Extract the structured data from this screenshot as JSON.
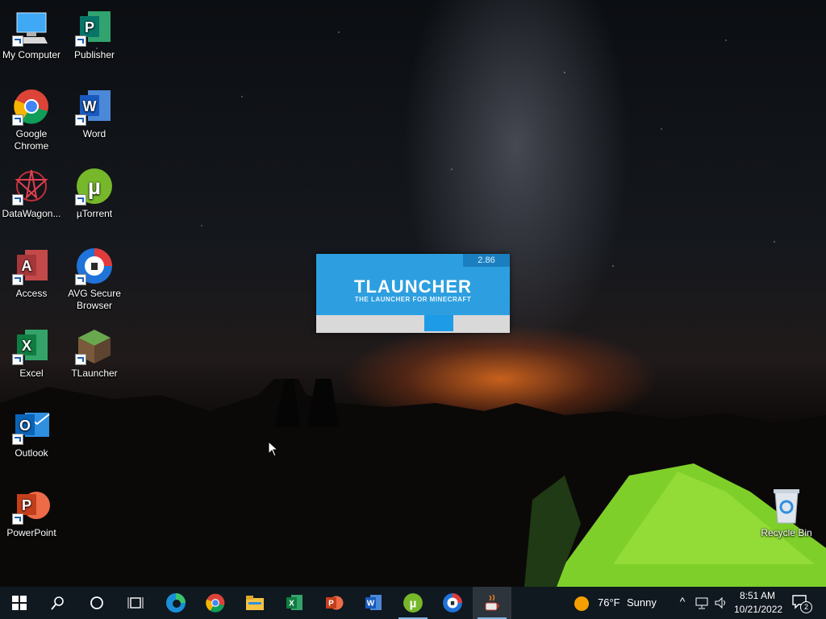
{
  "desktop_icons": [
    {
      "label": "My Computer"
    },
    {
      "label": "Publisher"
    },
    {
      "label": "Google Chrome"
    },
    {
      "label": "Word"
    },
    {
      "label": "DataWagon..."
    },
    {
      "label": "µTorrent"
    },
    {
      "label": "Access"
    },
    {
      "label": "AVG Secure Browser"
    },
    {
      "label": "Excel"
    },
    {
      "label": "TLauncher"
    },
    {
      "label": "Outlook"
    },
    {
      "label": "PowerPoint"
    },
    {
      "label": "Recycle Bin"
    }
  ],
  "splash": {
    "version": "2.86",
    "title": "TLAUNCHER",
    "subtitle": "THE LAUNCHER FOR MINECRAFT",
    "progress_fraction": 0.15,
    "progress_offset_fraction": 0.56
  },
  "taskbar": {
    "apps": [
      "start-icon",
      "search-icon",
      "cortana-icon",
      "task-view-icon",
      "edge-icon",
      "chrome-icon",
      "file-explorer-icon",
      "excel-icon",
      "powerpoint-icon",
      "word-icon",
      "utorrent-icon",
      "avg-browser-icon",
      "java-icon"
    ],
    "weather": {
      "temp": "76°F",
      "condition": "Sunny"
    },
    "time": "8:51 AM",
    "date": "10/21/2022",
    "notifications": "2"
  },
  "colors": {
    "taskbar": "#101820",
    "splash": "#2d9fe0",
    "progress": "#1e9be6"
  }
}
